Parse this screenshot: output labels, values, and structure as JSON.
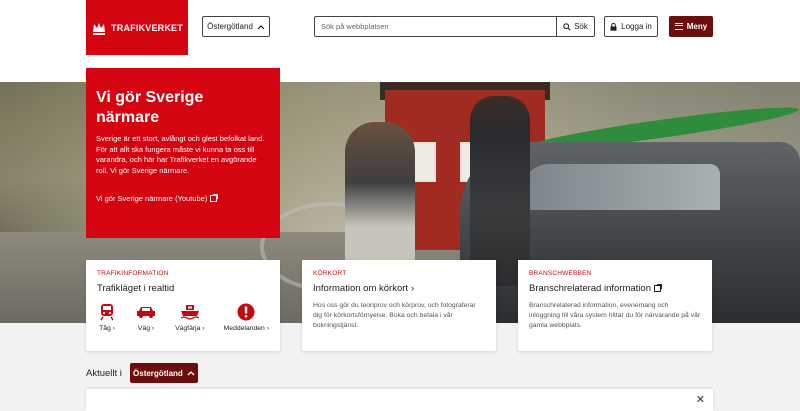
{
  "header": {
    "logo_text": "TRAFIKVERKET",
    "region": "Östergötland",
    "search_placeholder": "Sök på webbplatsen",
    "search_button": "Sök",
    "login": "Logga in",
    "menu": "Meny"
  },
  "hero": {
    "title": "Vi gör Sverige närmare",
    "text": "Sverige är ett stort, avlångt och glest befolkat land. För att allt ska fungera måste vi kunna ta oss till varandra, och här har Trafikverket en avgörande roll. Vi gör Sverige närmare.",
    "link": "Vi gör Sverige närmare (Youtube)"
  },
  "cards": {
    "traffic": {
      "category": "TRAFIKINFORMATION",
      "title": "Trafikläget i realtid",
      "items": [
        {
          "label": "Tåg",
          "icon": "train-icon"
        },
        {
          "label": "Väg",
          "icon": "car-icon"
        },
        {
          "label": "Vägfärja",
          "icon": "ferry-icon"
        },
        {
          "label": "Meddelanden",
          "icon": "alert-icon"
        }
      ]
    },
    "korkort": {
      "category": "KÖRKORT",
      "title": "Information om körkort",
      "text": "Hos oss gör du teoriprov och körprov, och fotograferar dig för körkortsförnyelse. Boka och betala i vår bokningstjänst."
    },
    "bransch": {
      "category": "BRANSCHWEBBEN",
      "title": "Branschrelaterad information",
      "text": "Branschrelaterad information, evenemang och inloggning till våra system hittar du för närvarande på vår gamla webbplats."
    }
  },
  "aktuellt": {
    "label": "Aktuellt i",
    "region": "Östergötland"
  },
  "colors": {
    "brand_red": "#d40511",
    "dark_red": "#6b0d0d"
  }
}
